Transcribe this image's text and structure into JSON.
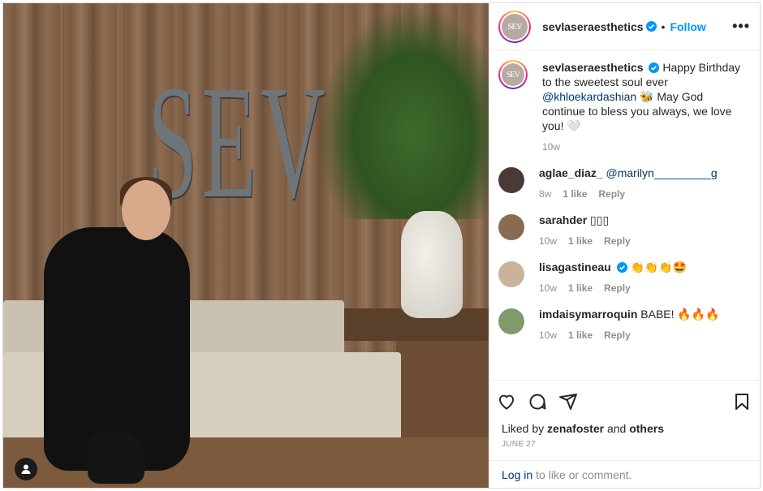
{
  "post": {
    "username": "sevlaseraesthetics",
    "follow_label": "Follow",
    "more_label": "•••",
    "dot": "•",
    "avatar_text": "SEV",
    "photo_sign_text": "SEV",
    "caption": {
      "text_before": "Happy Birthday to the sweetest soul ever",
      "mention": "@khloekardashian",
      "text_after": "🐝 May God continue to bless you always, we love you! 🤍",
      "time": "10w"
    }
  },
  "comments": [
    {
      "username": "aglae_diaz_",
      "verified": false,
      "mention": "@marilyn_________g",
      "text": "",
      "time": "8w",
      "likes": "1 like",
      "reply": "Reply",
      "avatar_color": "#4a3a35"
    },
    {
      "username": "sarahder",
      "verified": false,
      "mention": "",
      "text": "▯▯▯",
      "time": "10w",
      "likes": "1 like",
      "reply": "Reply",
      "avatar_color": "#8a6b4f"
    },
    {
      "username": "lisagastineau",
      "verified": true,
      "mention": "",
      "text": "👏👏👏🤩",
      "time": "10w",
      "likes": "1 like",
      "reply": "Reply",
      "avatar_color": "#c9b39a"
    },
    {
      "username": "imdaisymarroquin",
      "verified": false,
      "mention": "",
      "text": "BABE! 🔥🔥🔥",
      "time": "10w",
      "likes": "1 like",
      "reply": "Reply",
      "avatar_color": "#7f9b6a"
    }
  ],
  "footer": {
    "liked_prefix": "Liked by",
    "liked_user": "zenafoster",
    "liked_mid": "and",
    "liked_others": "others",
    "date": "JUNE 27",
    "login_link": "Log in",
    "login_rest": "to like or comment."
  },
  "colors": {
    "accent": "#0095f6",
    "verified": "#0095f6",
    "mention": "#00376b"
  }
}
